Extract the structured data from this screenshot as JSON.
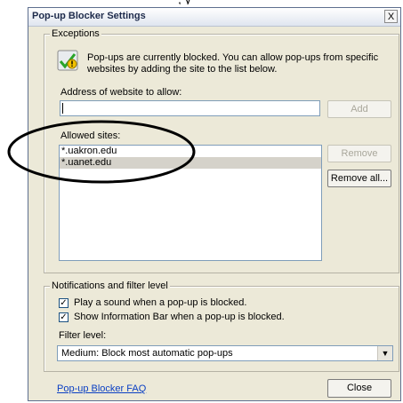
{
  "cropped_caption": ", y",
  "dialog": {
    "title": "Pop-up Blocker Settings",
    "close_glyph": "X"
  },
  "exceptions": {
    "legend": "Exceptions",
    "icon": "warning-shield-icon",
    "message": "Pop-ups are currently blocked.  You can allow pop-ups from specific websites by adding the site to the list below.",
    "address_label": "Address of website to allow:",
    "address_value": "",
    "add_label": "Add",
    "allowed_label": "Allowed sites:",
    "allowed_sites": [
      "*.uakron.edu",
      "*.uanet.edu"
    ],
    "selected_index": 1,
    "remove_label": "Remove",
    "remove_all_label": "Remove all..."
  },
  "notifications": {
    "legend": "Notifications and filter level",
    "play_sound_label": "Play a sound when a pop-up is blocked.",
    "play_sound_checked": true,
    "show_info_label": "Show Information Bar when a pop-up is blocked.",
    "show_info_checked": true,
    "filter_label": "Filter level:",
    "filter_value": "Medium: Block most automatic pop-ups"
  },
  "footer": {
    "faq_link": "Pop-up Blocker FAQ",
    "close_label": "Close"
  }
}
